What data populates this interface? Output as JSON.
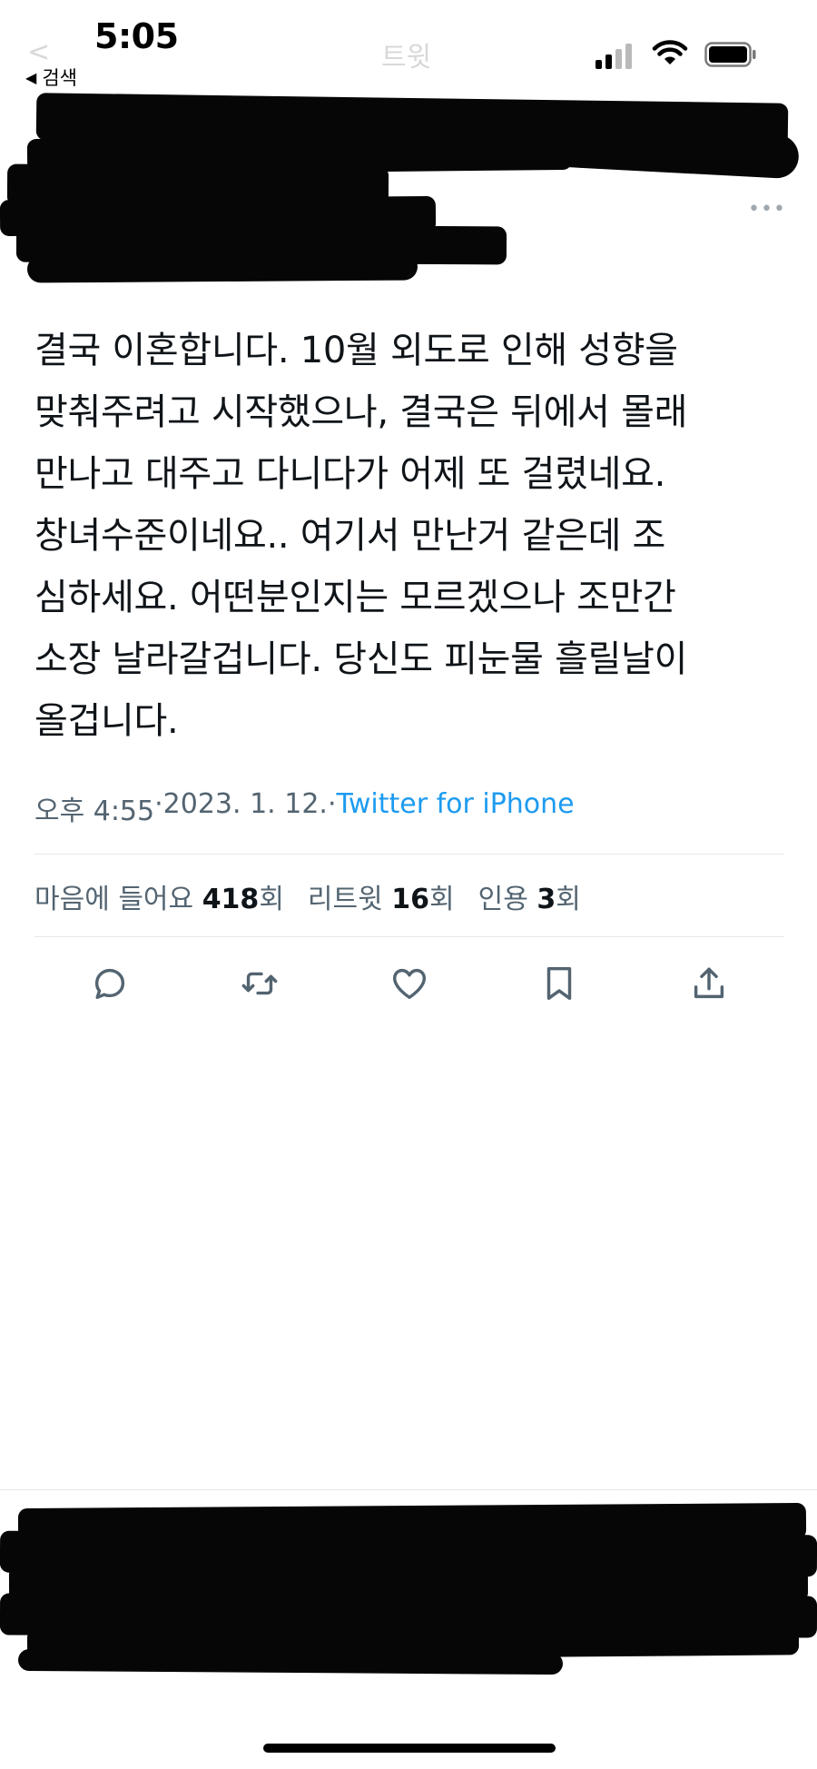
{
  "status_bar": {
    "time": "5:05",
    "back_label": "검색",
    "back_glyph": "◀",
    "ghost_title": "트윗",
    "icons": [
      "cellular-signal-icon",
      "wifi-icon",
      "battery-icon"
    ]
  },
  "header": {
    "more_glyph": "•••"
  },
  "tweet": {
    "text": "결국 이혼합니다. 10월 외도로 인해 성향을\n맞춰주려고 시작했으나, 결국은 뒤에서 몰래\n만나고 대주고 다니다가 어제 또 걸렸네요.\n창녀수준이네요.. 여기서 만난거 같은데 조\n심하세요. 어떤분인지는 모르겠으나 조만간\n소장 날라갈겁니다. 당신도 피눈물 흘릴날이\n올겁니다.",
    "time": "오후 4:55",
    "separator": " · ",
    "date": "2023. 1. 12.",
    "source": "Twitter for iPhone"
  },
  "stats": {
    "likes_label": "마음에 들어요",
    "likes_count": "418",
    "likes_suffix": "회",
    "retweets_label": "리트윗",
    "retweets_count": "16",
    "retweets_suffix": "회",
    "quotes_label": "인용",
    "quotes_count": "3",
    "quotes_suffix": "회"
  },
  "actions": [
    "reply-icon",
    "retweet-icon",
    "like-icon",
    "bookmark-icon",
    "share-icon"
  ],
  "colors": {
    "text": "#0f1419",
    "secondary": "#536471",
    "link": "#1d9bf0",
    "divider": "#e4e8eb",
    "redaction": "#060606"
  }
}
